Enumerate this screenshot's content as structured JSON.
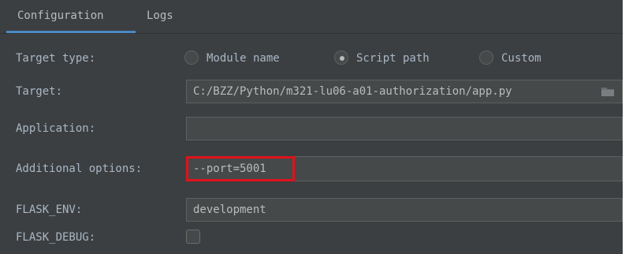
{
  "tabs": {
    "configuration": "Configuration",
    "logs": "Logs"
  },
  "target_type": {
    "label": "Target type:",
    "options": [
      "Module name",
      "Script path",
      "Custom"
    ],
    "selected": "Script path"
  },
  "target": {
    "label": "Target:",
    "value": "C:/BZZ/Python/m321-lu06-a01-authorization/app.py"
  },
  "application": {
    "label": "Application:",
    "value": ""
  },
  "additional_options": {
    "label": "Additional options:",
    "value": "--port=5001"
  },
  "flask_env": {
    "label": "FLASK_ENV:",
    "value": "development"
  },
  "flask_debug": {
    "label": "FLASK_DEBUG:",
    "checked": false
  },
  "colors": {
    "panel_bg": "#3c3f41",
    "field_bg": "#45494a",
    "accent": "#4a88c7",
    "highlight": "#e0121a"
  }
}
